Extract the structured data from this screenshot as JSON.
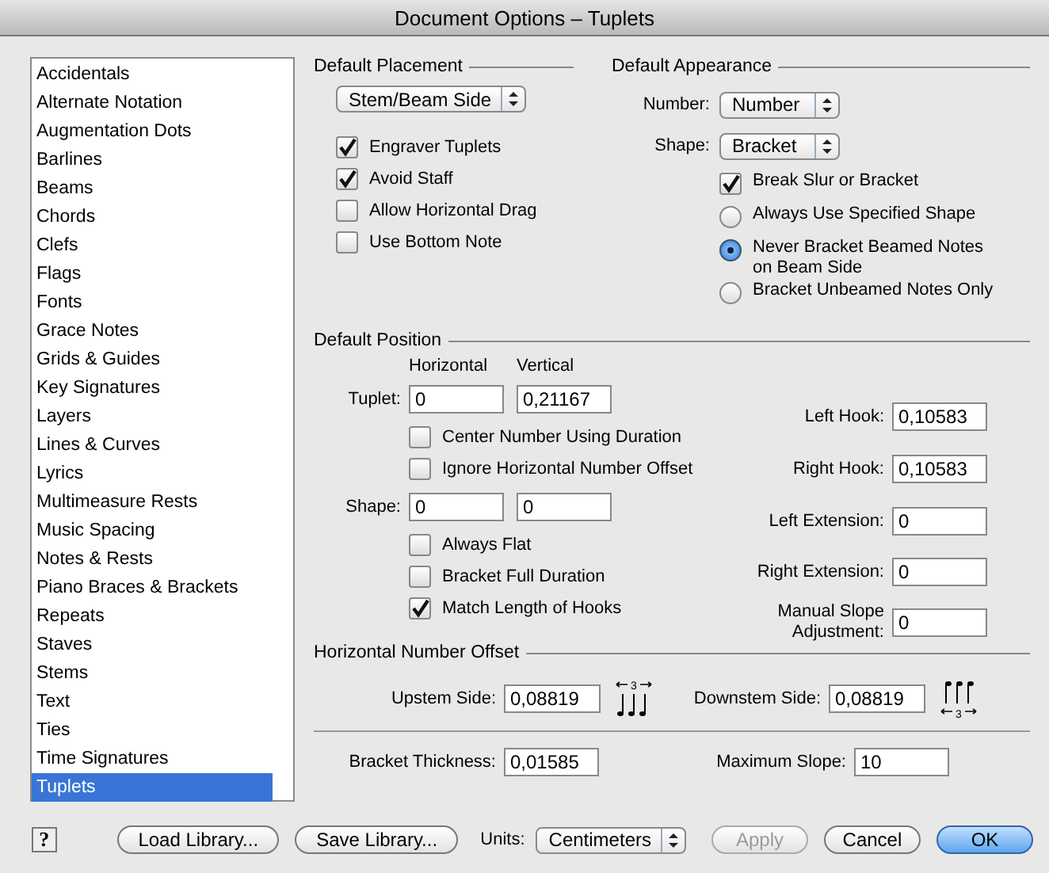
{
  "window": {
    "title": "Document Options – Tuplets"
  },
  "sidebar": {
    "items": [
      {
        "label": "Accidentals",
        "selected": false
      },
      {
        "label": "Alternate Notation",
        "selected": false
      },
      {
        "label": "Augmentation Dots",
        "selected": false
      },
      {
        "label": "Barlines",
        "selected": false
      },
      {
        "label": "Beams",
        "selected": false
      },
      {
        "label": "Chords",
        "selected": false
      },
      {
        "label": "Clefs",
        "selected": false
      },
      {
        "label": "Flags",
        "selected": false
      },
      {
        "label": "Fonts",
        "selected": false
      },
      {
        "label": "Grace Notes",
        "selected": false
      },
      {
        "label": "Grids & Guides",
        "selected": false
      },
      {
        "label": "Key Signatures",
        "selected": false
      },
      {
        "label": "Layers",
        "selected": false
      },
      {
        "label": "Lines & Curves",
        "selected": false
      },
      {
        "label": "Lyrics",
        "selected": false
      },
      {
        "label": "Multimeasure Rests",
        "selected": false
      },
      {
        "label": "Music Spacing",
        "selected": false
      },
      {
        "label": "Notes & Rests",
        "selected": false
      },
      {
        "label": "Piano Braces & Brackets",
        "selected": false
      },
      {
        "label": "Repeats",
        "selected": false
      },
      {
        "label": "Staves",
        "selected": false
      },
      {
        "label": "Stems",
        "selected": false
      },
      {
        "label": "Text",
        "selected": false
      },
      {
        "label": "Ties",
        "selected": false
      },
      {
        "label": "Time Signatures",
        "selected": false
      },
      {
        "label": "Tuplets",
        "selected": true
      }
    ]
  },
  "default_placement": {
    "title": "Default Placement",
    "popup": "Stem/Beam Side",
    "options": [
      {
        "kind": "checkbox",
        "label": "Engraver Tuplets",
        "checked": true
      },
      {
        "kind": "checkbox",
        "label": "Avoid Staff",
        "checked": true
      },
      {
        "kind": "checkbox",
        "label": "Allow Horizontal Drag",
        "checked": false
      },
      {
        "kind": "checkbox",
        "label": "Use Bottom Note",
        "checked": false
      }
    ]
  },
  "default_appearance": {
    "title": "Default Appearance",
    "popups": [
      {
        "label": "Number:",
        "value": "Number"
      },
      {
        "label": "Shape:",
        "value": "Bracket"
      }
    ],
    "options": [
      {
        "kind": "checkbox",
        "label": "Break Slur or Bracket",
        "checked": true
      },
      {
        "kind": "radio",
        "label": "Always Use Specified Shape",
        "selected": false
      },
      {
        "kind": "radio",
        "label": "Never Bracket Beamed Notes on Beam Side",
        "selected": true
      },
      {
        "kind": "radio",
        "label": "Bracket Unbeamed Notes Only",
        "selected": false
      }
    ]
  },
  "default_position": {
    "title": "Default Position",
    "column_headers": [
      "Horizontal",
      "Vertical"
    ],
    "tuplet": {
      "label": "Tuplet:",
      "horizontal": "0",
      "vertical": "0,21167"
    },
    "tuplet_options": [
      {
        "label": "Center Number Using Duration",
        "checked": false
      },
      {
        "label": "Ignore Horizontal Number Offset",
        "checked": false
      }
    ],
    "shape": {
      "label": "Shape:",
      "horizontal": "0",
      "vertical": "0"
    },
    "shape_options": [
      {
        "label": "Always Flat",
        "checked": false
      },
      {
        "label": "Bracket Full Duration",
        "checked": false
      },
      {
        "label": "Match Length of Hooks",
        "checked": true
      }
    ],
    "fields": [
      {
        "label": "Left Hook:",
        "value": "0,10583"
      },
      {
        "label": "Right Hook:",
        "value": "0,10583"
      },
      {
        "label": "Left Extension:",
        "value": "0"
      },
      {
        "label": "Right Extension:",
        "value": "0"
      },
      {
        "label": "Manual Slope Adjustment:",
        "value": "0"
      }
    ]
  },
  "horizontal_number_offset": {
    "title": "Horizontal Number Offset",
    "fields": [
      {
        "label": "Upstem Side:",
        "value": "0,08819",
        "tuplet_number": "3"
      },
      {
        "label": "Downstem Side:",
        "value": "0,08819",
        "tuplet_number": "3"
      }
    ]
  },
  "bracket_fields": [
    {
      "label": "Bracket Thickness:",
      "value": "0,01585"
    },
    {
      "label": "Maximum Slope:",
      "value": "10"
    }
  ],
  "footer": {
    "help": "?",
    "library_buttons": [
      "Load Library...",
      "Save Library..."
    ],
    "units": {
      "label": "Units:",
      "value": "Centimeters"
    },
    "action_buttons": [
      {
        "label": "Apply",
        "disabled": true,
        "default": false
      },
      {
        "label": "Cancel",
        "disabled": false,
        "default": false
      },
      {
        "label": "OK",
        "disabled": false,
        "default": true
      }
    ]
  }
}
